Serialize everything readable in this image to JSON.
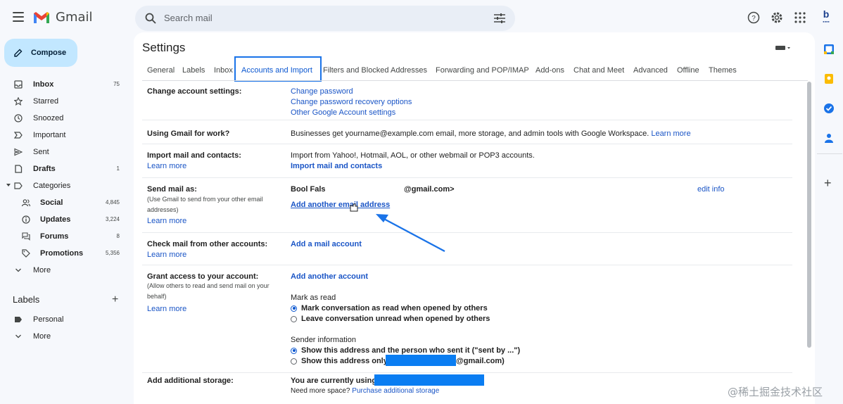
{
  "app": {
    "name": "Gmail"
  },
  "search": {
    "placeholder": "Search mail"
  },
  "compose": {
    "label": "Compose"
  },
  "nav": [
    {
      "label": "Inbox",
      "count": "75",
      "icon": "inbox-icon",
      "bold": true
    },
    {
      "label": "Starred",
      "count": "",
      "icon": "star-icon"
    },
    {
      "label": "Snoozed",
      "count": "",
      "icon": "clock-icon"
    },
    {
      "label": "Important",
      "count": "",
      "icon": "important-icon"
    },
    {
      "label": "Sent",
      "count": "",
      "icon": "send-icon"
    },
    {
      "label": "Drafts",
      "count": "1",
      "icon": "draft-icon",
      "bold": true
    },
    {
      "label": "Categories",
      "count": "",
      "icon": "label-icon"
    },
    {
      "label": "Social",
      "count": "4,845",
      "icon": "people-icon",
      "sub": true
    },
    {
      "label": "Updates",
      "count": "3,224",
      "icon": "info-icon",
      "sub": true
    },
    {
      "label": "Forums",
      "count": "8",
      "icon": "forum-icon",
      "sub": true
    },
    {
      "label": "Promotions",
      "count": "5,356",
      "icon": "tag-icon",
      "sub": true
    },
    {
      "label": "More",
      "count": "",
      "icon": "chevron-down-icon"
    }
  ],
  "labels": {
    "heading": "Labels",
    "items": [
      {
        "label": "Personal"
      },
      {
        "label": "More"
      }
    ]
  },
  "settings": {
    "title": "Settings",
    "tabs": [
      "General",
      "Labels",
      "Inbox",
      "Accounts and Import",
      "Filters and Blocked Addresses",
      "Forwarding and POP/IMAP",
      "Add-ons",
      "Chat and Meet",
      "Advanced",
      "Offline",
      "Themes"
    ],
    "active_tab": "Accounts and Import",
    "change_account": {
      "label": "Change account settings:",
      "links": [
        "Change password",
        "Change password recovery options",
        "Other Google Account settings"
      ]
    },
    "work": {
      "label": "Using Gmail for work?",
      "text": "Businesses get yourname@example.com email, more storage, and admin tools with Google Workspace.",
      "link": "Learn more"
    },
    "import": {
      "label": "Import mail and contacts:",
      "learn": "Learn more",
      "text": "Import from Yahoo!, Hotmail, AOL, or other webmail or POP3 accounts.",
      "link": "Import mail and contacts"
    },
    "send_as": {
      "label": "Send mail as:",
      "note": "(Use Gmail to send from your other email addresses)",
      "learn": "Learn more",
      "name_start": "Bool Fals",
      "name_end": "@gmail.com>",
      "edit": "edit info",
      "add": "Add another email address"
    },
    "check_mail": {
      "label": "Check mail from other accounts:",
      "learn": "Learn more",
      "link": "Add a mail account"
    },
    "grant": {
      "label": "Grant access to your account:",
      "note": "(Allow others to read and send mail on your behalf)",
      "learn": "Learn more",
      "link": "Add another account",
      "mark_heading": "Mark as read",
      "mark_opt1": "Mark conversation as read when opened by others",
      "mark_opt2": "Leave conversation unread when opened by others",
      "sender_heading": "Sender information",
      "sender_opt1": "Show this address and the person who sent it (\"sent by ...\")",
      "sender_opt2_start": "Show this address only",
      "sender_opt2_end": "@gmail.com)"
    },
    "storage": {
      "label": "Add additional storage:",
      "text": "You are currently using",
      "need": "Need more space?",
      "link": "Purchase additional storage"
    }
  },
  "colors": {
    "accent": "#1a73e8",
    "link": "#1a55c6",
    "compose": "#c2e7ff",
    "redaction": "#0a7df2"
  },
  "watermark": "@稀土掘金技术社区"
}
